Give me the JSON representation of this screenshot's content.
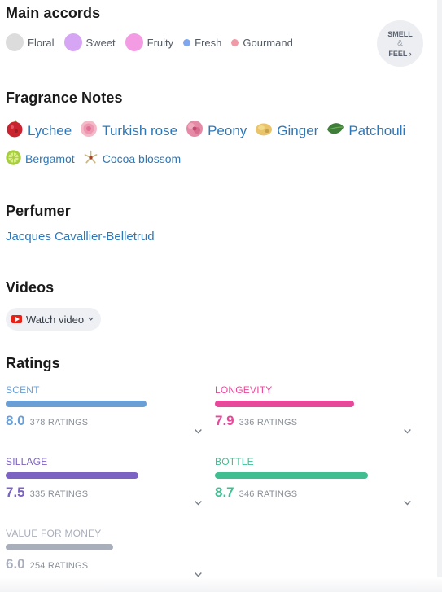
{
  "accords": {
    "title": "Main accords",
    "items": [
      {
        "label": "Floral",
        "color": "#dcdcdc",
        "size": 22
      },
      {
        "label": "Sweet",
        "color": "#d6a5f3",
        "size": 22
      },
      {
        "label": "Fruity",
        "color": "#f39be3",
        "size": 22
      },
      {
        "label": "Fresh",
        "color": "#7fa6ef",
        "size": 9
      },
      {
        "label": "Gourmand",
        "color": "#ef9aa6",
        "size": 9
      }
    ],
    "smell_top": "SMELL",
    "smell_amp": "&",
    "smell_bottom": "FEEL ›"
  },
  "notes": {
    "title": "Fragrance Notes",
    "row1": [
      {
        "label": "Lychee",
        "icon": "lychee-icon"
      },
      {
        "label": "Turkish rose",
        "icon": "rose-icon"
      },
      {
        "label": "Peony",
        "icon": "peony-icon"
      },
      {
        "label": "Ginger",
        "icon": "ginger-icon"
      },
      {
        "label": "Patchouli",
        "icon": "patchouli-icon"
      }
    ],
    "row2": [
      {
        "label": "Bergamot",
        "icon": "bergamot-icon"
      },
      {
        "label": "Cocoa blossom",
        "icon": "cocoa-blossom-icon"
      }
    ]
  },
  "perfumer": {
    "title": "Perfumer",
    "name": "Jacques Cavallier-Belletrud"
  },
  "videos": {
    "title": "Videos",
    "button_label": "Watch video"
  },
  "ratings": {
    "title": "Ratings",
    "items": [
      {
        "key": "scent",
        "label": "SCENT",
        "value": "8.0",
        "count": "378 RATINGS",
        "color": "#6a9fd6",
        "fill": 0.9
      },
      {
        "key": "longevity",
        "label": "LONGEVITY",
        "value": "7.9",
        "count": "336 RATINGS",
        "color": "#e8489a",
        "fill": 0.89
      },
      {
        "key": "sillage",
        "label": "SILLAGE",
        "value": "7.5",
        "count": "335 RATINGS",
        "color": "#7c62c2",
        "fill": 0.85
      },
      {
        "key": "bottle",
        "label": "BOTTLE",
        "value": "8.7",
        "count": "346 RATINGS",
        "color": "#3fbf91",
        "fill": 0.98
      },
      {
        "key": "value",
        "label": "VALUE FOR MONEY",
        "value": "6.0",
        "count": "254 RATINGS",
        "color": "#a9aebb",
        "fill": 0.69
      }
    ]
  }
}
